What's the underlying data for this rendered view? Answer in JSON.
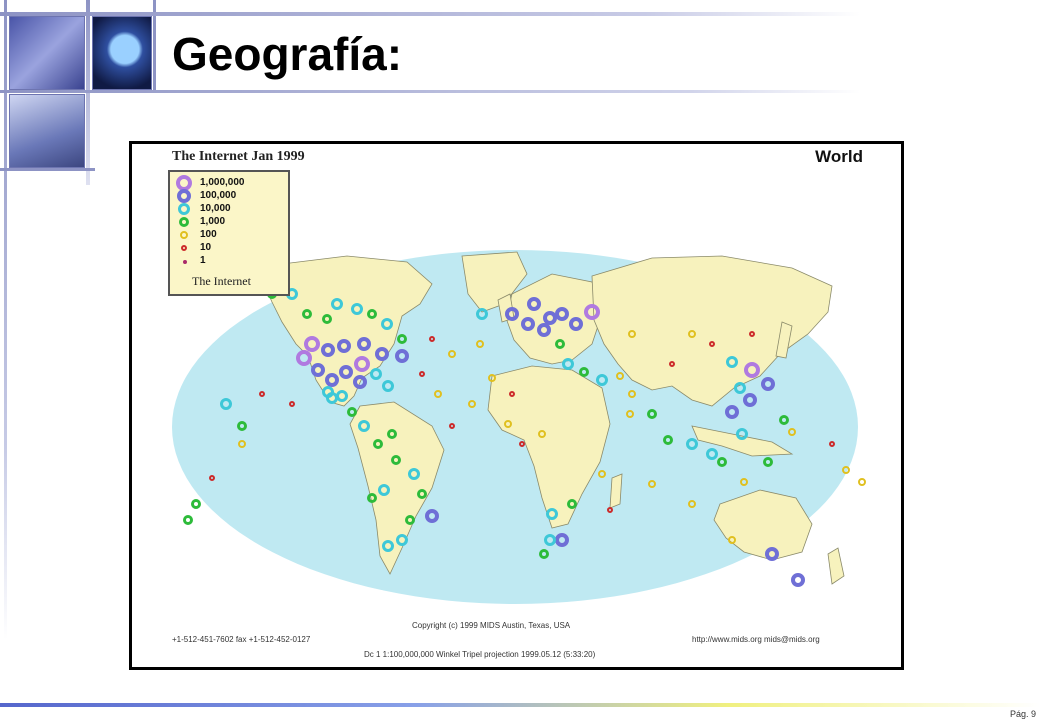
{
  "slide": {
    "title": "Geografía:",
    "page_number": "Pág. 9"
  },
  "map": {
    "title": "The Internet  Jan 1999",
    "region": "World",
    "legend": {
      "items": [
        {
          "label": "1,000,000",
          "color": "#b07ae0",
          "size": 16,
          "stroke": 4
        },
        {
          "label": "100,000",
          "color": "#6f6fd6",
          "size": 14,
          "stroke": 4
        },
        {
          "label": "10,000",
          "color": "#3ec8d8",
          "size": 12,
          "stroke": 3
        },
        {
          "label": "1,000",
          "color": "#2dbb3a",
          "size": 10,
          "stroke": 3
        },
        {
          "label": "100",
          "color": "#e0c020",
          "size": 8,
          "stroke": 2
        },
        {
          "label": "10",
          "color": "#cc2a2a",
          "size": 6,
          "stroke": 2
        },
        {
          "label": "1",
          "color": "#aa2a6a",
          "size": 3,
          "stroke": 2
        }
      ],
      "caption": "The Internet"
    },
    "credits": {
      "copyright": "Copyright (c) 1999  MIDS  Austin, Texas, USA",
      "phone": "+1-512-451-7602 fax +1-512-452-0127",
      "url": "http://www.mids.org  mids@mids.org",
      "projection": "Dc 1 1:100,000,000 Winkel Tripel projection 1999.05.12 (5:33:20)"
    },
    "colors": {
      "ocean": "#bfe9f2",
      "land": "#f7f2bd",
      "border": "#8a8a6a"
    }
  }
}
